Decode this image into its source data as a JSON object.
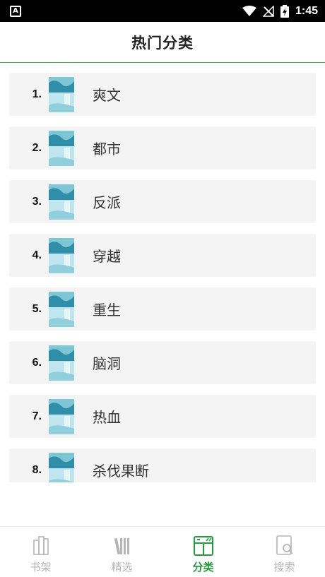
{
  "status_bar": {
    "time": "1:45",
    "app_icon": "A"
  },
  "header": {
    "title": "热门分类"
  },
  "categories": [
    {
      "rank": "1.",
      "name": "爽文"
    },
    {
      "rank": "2.",
      "name": "都市"
    },
    {
      "rank": "3.",
      "name": "反派"
    },
    {
      "rank": "4.",
      "name": "穿越"
    },
    {
      "rank": "5.",
      "name": "重生"
    },
    {
      "rank": "6.",
      "name": "脑洞"
    },
    {
      "rank": "7.",
      "name": "热血"
    },
    {
      "rank": "8.",
      "name": "杀伐果断"
    }
  ],
  "nav": {
    "items": [
      {
        "label": "书架",
        "icon": "bookshelf-icon"
      },
      {
        "label": "精选",
        "icon": "books-icon"
      },
      {
        "label": "分类",
        "icon": "category-icon"
      },
      {
        "label": "搜索",
        "icon": "search-icon"
      }
    ],
    "active_color": "#1f9e3a",
    "inactive_color": "#b5b5b5"
  }
}
